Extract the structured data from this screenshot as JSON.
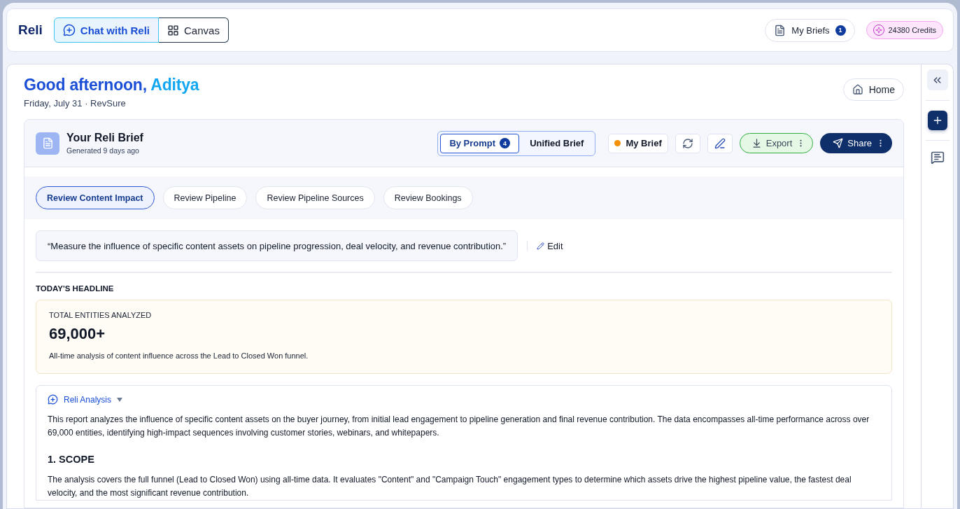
{
  "header": {
    "logo": "Reli",
    "mode_tabs": [
      {
        "label": "Chat with Reli",
        "kind": "chat",
        "selected": true
      },
      {
        "label": "Canvas",
        "kind": "canvas",
        "selected": false
      }
    ],
    "my_briefs": {
      "label": "My Briefs",
      "count": "1"
    },
    "credits": "24380 Credits"
  },
  "greeting": {
    "text": "Good afternoon, ",
    "name": "Aditya",
    "subtitle": "Friday, July 31 · RevSure"
  },
  "home_button": "Home",
  "brief": {
    "title": "Your Reli Brief",
    "generated": "Generated 9 days ago",
    "view_tabs": [
      {
        "label": "By Prompt",
        "count": "4",
        "selected": true
      },
      {
        "label": "Unified Brief",
        "selected": false
      }
    ],
    "my_brief": "My Brief",
    "export": "Export",
    "share": "Share",
    "prompt_tabs": [
      {
        "label": "Review Content Impact",
        "selected": true
      },
      {
        "label": "Review Pipeline",
        "selected": false
      },
      {
        "label": "Review Pipeline Sources",
        "selected": false
      },
      {
        "label": "Review Bookings",
        "selected": false
      }
    ],
    "prompt": "“Measure the influence of specific content assets on pipeline progression, deal velocity, and revenue contribution.”",
    "edit": "Edit",
    "headline_label": "TODAY'S HEADLINE",
    "headline": {
      "label": "TOTAL ENTITIES ANALYZED",
      "value": "69,000+",
      "caption": "All-time analysis of content influence across the Lead to Closed Won funnel."
    },
    "analysis": {
      "title": "Reli Analysis",
      "expanded": true,
      "intro": "This report analyzes the influence of specific content assets on the buyer journey, from initial lead engagement to pipeline generation and final revenue contribution. The data encompasses all-time performance across over 69,000 entities, identifying high-impact sequences involving customer stories, webinars, and whitepapers.",
      "sections": [
        {
          "heading": "1. SCOPE",
          "text": "The analysis covers the full funnel (Lead to Closed Won) using all-time data. It evaluates \"Content\" and \"Campaign Touch\" engagement types to determine which assets drive the highest pipeline value, the fastest deal velocity, and the most significant revenue contribution."
        }
      ]
    }
  }
}
